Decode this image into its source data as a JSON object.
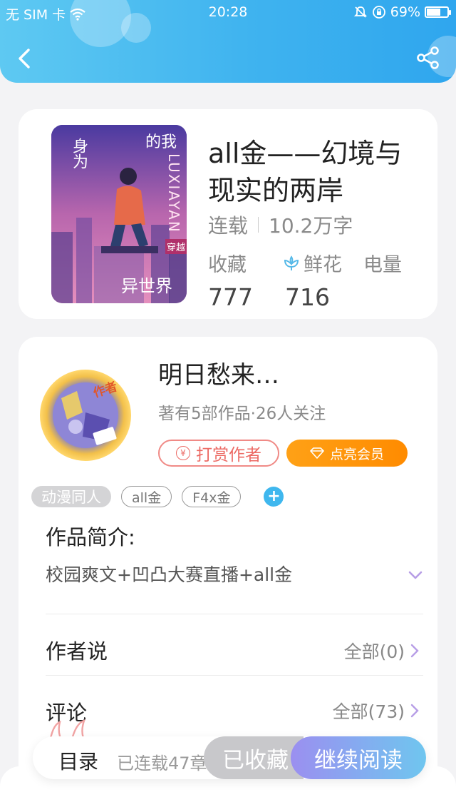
{
  "status_bar": {
    "carrier": "无 SIM 卡",
    "time": "20:28",
    "battery": "69%",
    "battery_level": 0.69
  },
  "book": {
    "title": "all金——幻境与现实的两岸",
    "status": "连载",
    "word_count": "10.2万字",
    "stats": {
      "favorites_label": "收藏",
      "flowers_label": "鲜花",
      "power_label": "电量",
      "favorites_value": "777",
      "flowers_value": "716"
    },
    "cover_text": {
      "line1": "身为",
      "line2": "的我",
      "line3": "异世界",
      "badge": "穿越",
      "vertical": "LUXIAYAN"
    }
  },
  "author": {
    "name": "明日愁来…",
    "summary": "著有5部作品·26人关注",
    "badge": "作者",
    "tip_button": "打赏作者",
    "tip_icon": "¥",
    "vip_button": "点亮会员"
  },
  "tags": [
    "动漫同人",
    "all金",
    "F4x金"
  ],
  "tag_add_label": "+",
  "intro": {
    "title": "作品简介:",
    "text": "校园爽文+凹凸大赛直播+all金"
  },
  "author_says": {
    "title": "作者说",
    "link": "全部(0)"
  },
  "comments": {
    "title": "评论",
    "link": "全部(73)"
  },
  "bottom_bar": {
    "toc": "目录",
    "progress": "已连载47章",
    "favorited": "已收藏",
    "continue": "继续阅读"
  },
  "colors": {
    "header_start": "#5ec9f2",
    "header_end": "#2fa6ee",
    "tip_red": "#ec6a64",
    "vip_orange": "#ff9a0a",
    "tag_add_blue": "#3fb7ee",
    "read_start": "#9b8ff0",
    "read_end": "#6fc6ef"
  },
  "icons": {
    "back": "chevron-left-icon",
    "share": "share-icon",
    "wifi": "wifi-icon",
    "alarm": "alarm-off-icon",
    "lock": "rotation-lock-icon",
    "flower": "flower-icon",
    "diamond": "diamond-icon",
    "expand": "chevron-down-icon",
    "row_arrow": "chevron-right-icon"
  }
}
